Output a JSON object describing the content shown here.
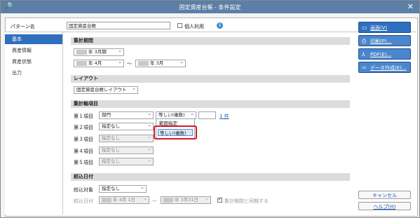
{
  "window": {
    "title": "固定資産台帳 - 条件設定"
  },
  "pattern": {
    "label": "パターン名",
    "value": "固定資産台帳",
    "personal_label": "個人利用",
    "personal_checked": false
  },
  "sidebar": {
    "items": [
      {
        "label": "基本",
        "active": true
      },
      {
        "label": "資産情報",
        "active": false
      },
      {
        "label": "資産状態",
        "active": false
      },
      {
        "label": "出力",
        "active": false
      }
    ]
  },
  "period": {
    "header": "集計期間",
    "term": "3月期",
    "term_year_suffix": "年",
    "from_year_suffix": "年",
    "from_month": "4月",
    "tilde": "〜",
    "to_year_suffix": "年",
    "to_month": "3月"
  },
  "layout": {
    "header": "レイアウト",
    "value": "固定資産台帳レイアウト"
  },
  "axis": {
    "header": "集計軸項目",
    "rows": [
      {
        "label": "第１項目",
        "item": "部門",
        "cond": "等しい(複数)",
        "count": "1 件"
      },
      {
        "label": "第２項目",
        "item": "指定なし"
      },
      {
        "label": "第３項目",
        "item": "指定なし"
      },
      {
        "label": "第４項目",
        "item": "指定なし"
      },
      {
        "label": "第５項目",
        "item": "指定なし"
      }
    ],
    "dropdown_options": [
      "範囲指定",
      "等しい(複数)"
    ]
  },
  "filter": {
    "header": "絞込日付",
    "target_label": "絞込対象",
    "target_value": "指定なし",
    "date_label": "絞込日付",
    "from_text": "年  4月  1日",
    "tilde": "〜",
    "to_text": "年  3月31日",
    "sync_label": "集計期間と同期する",
    "sync_checked": true
  },
  "buttons": {
    "screen": "画面(V)",
    "print": "印刷(P)...",
    "pdf": "PDF(E)...",
    "data": "データ作成(E)...",
    "cancel": "キャンセル",
    "help": "ヘルプ(H)"
  },
  "colors": {
    "accent": "#2f6fbf",
    "titlebar": "#5b7fa6",
    "highlight": "#d7192b"
  }
}
